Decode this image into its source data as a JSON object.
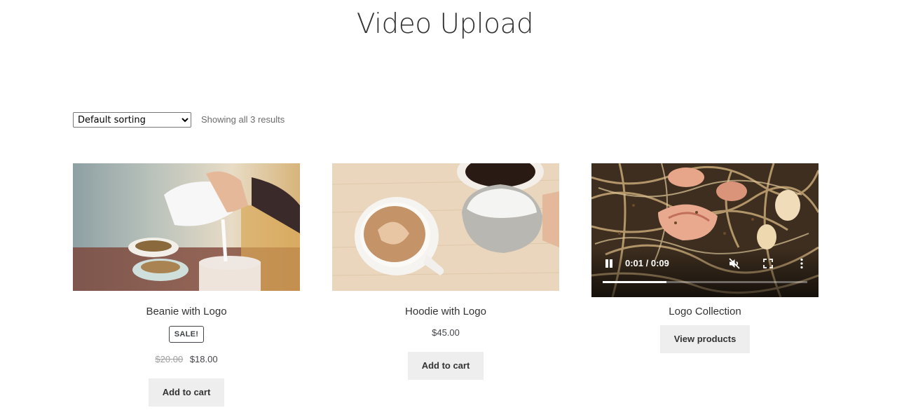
{
  "page": {
    "title": "Video Upload"
  },
  "toolbar": {
    "sorting_selected": "Default sorting",
    "result_count": "Showing all 3 results"
  },
  "products": [
    {
      "title": "Beanie with Logo",
      "badge": "SALE!",
      "regular_price": "$20.00",
      "sale_price": "$18.00",
      "button_label": "Add to cart"
    },
    {
      "title": "Hoodie with Logo",
      "price": "$45.00",
      "button_label": "Add to cart"
    },
    {
      "title": "Logo Collection",
      "button_label": "View products",
      "video": {
        "time": "0:01 / 0:09",
        "progress": 0.31,
        "state": "playing",
        "muted": true
      }
    }
  ]
}
